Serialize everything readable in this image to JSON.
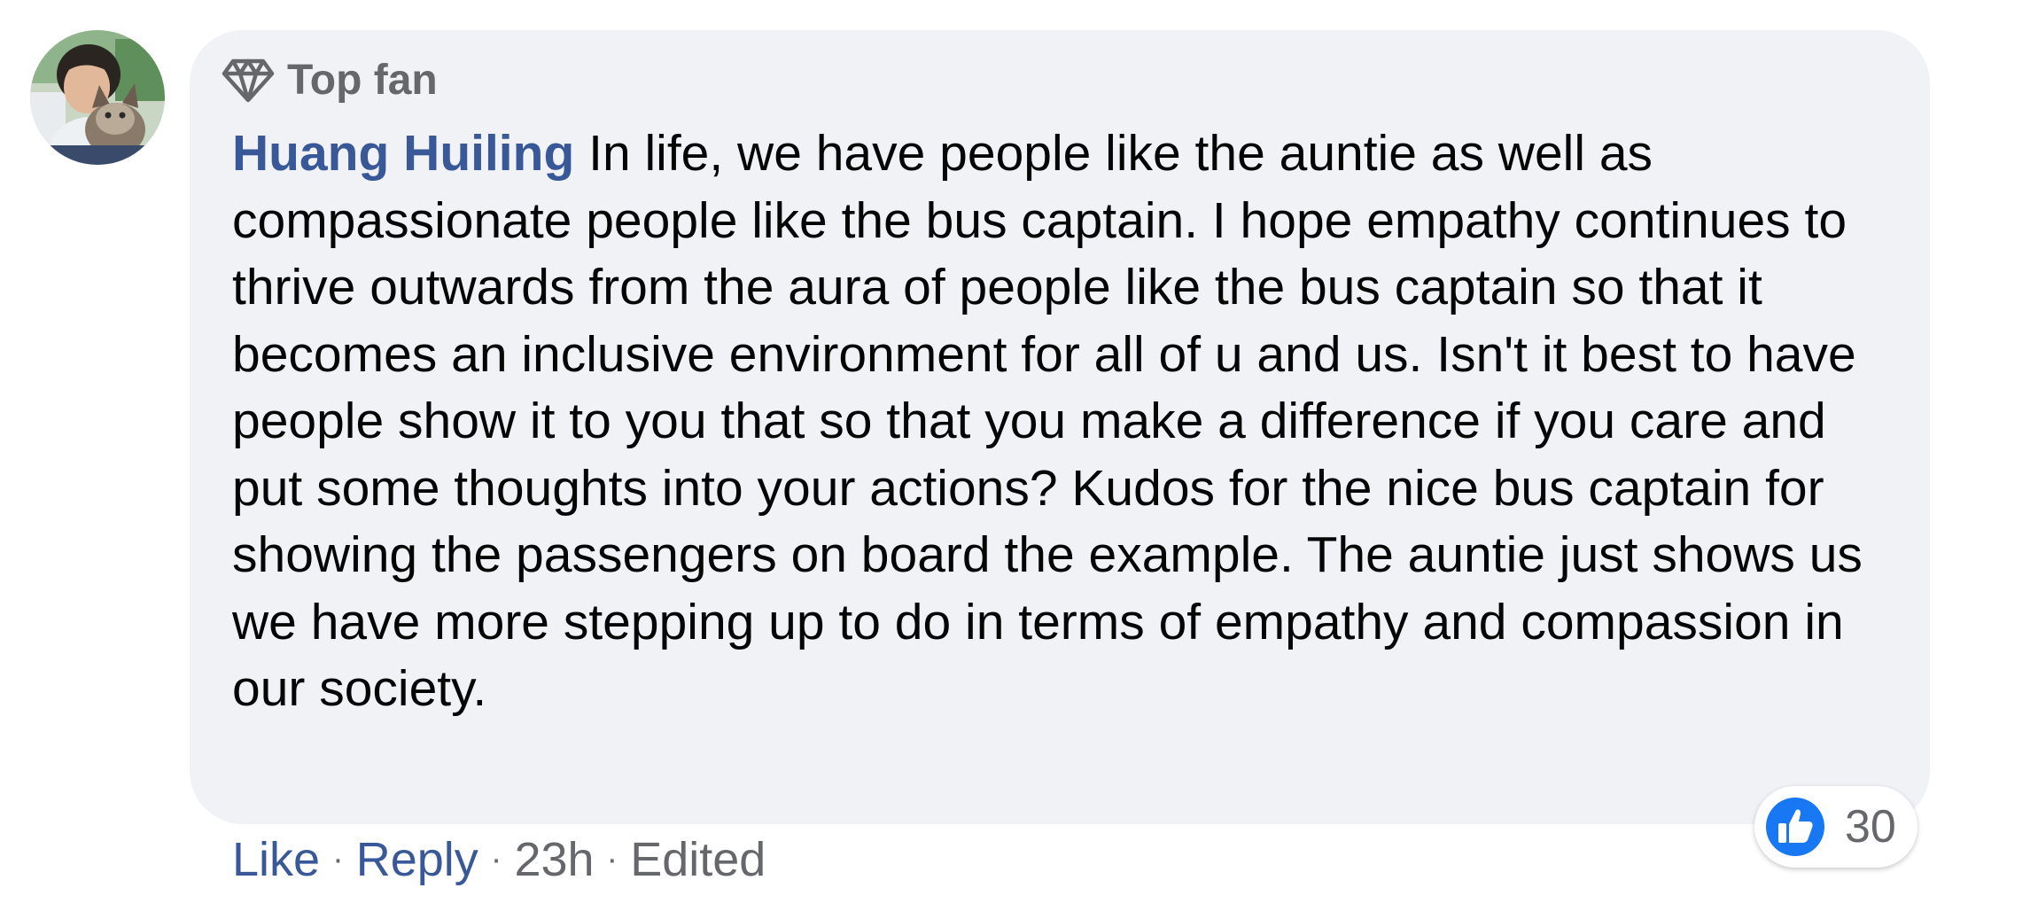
{
  "comment": {
    "badge": {
      "icon": "diamond-icon",
      "label": "Top fan"
    },
    "author": "Huang Huiling",
    "text": "In life, we have people like the auntie as well as compassionate people like the bus captain. I hope empathy continues to thrive outwards from the aura of people like the bus captain so that it becomes an inclusive environment for all of u and us. Isn't it best to have people show it to you that so that you make a difference if you care and put some thoughts into your actions? Kudos for the nice bus captain for showing the passengers on board the example. The auntie just shows us we have more stepping up to do in terms of empathy and compassion in our society.",
    "reactions": {
      "icon": "thumbs-up-icon",
      "count": "30"
    },
    "actions": {
      "like": "Like",
      "reply": "Reply",
      "time": "23h",
      "edited": "Edited",
      "separator": "·"
    }
  },
  "colors": {
    "link": "#385898",
    "bubble": "#f0f2f5",
    "muted": "#65676b",
    "like_blue": "#1877f2"
  }
}
